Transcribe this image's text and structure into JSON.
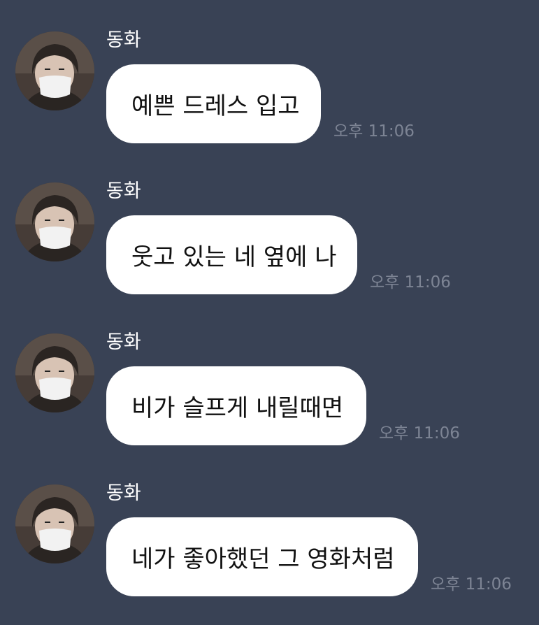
{
  "colors": {
    "background": "#394255",
    "bubble": "#ffffff",
    "bubble_text": "#111111",
    "sender_text": "#ffffff",
    "timestamp_text": "#7d8494"
  },
  "messages": [
    {
      "sender": "동화",
      "text": "예쁜 드레스 입고",
      "time": "오후 11:06",
      "avatar_icon": "profile-photo"
    },
    {
      "sender": "동화",
      "text": "웃고 있는 네 옆에 나",
      "time": "오후 11:06",
      "avatar_icon": "profile-photo"
    },
    {
      "sender": "동화",
      "text": "비가 슬프게 내릴때면",
      "time": "오후 11:06",
      "avatar_icon": "profile-photo"
    },
    {
      "sender": "동화",
      "text": "네가 좋아했던 그 영화처럼",
      "time": "오후 11:06",
      "avatar_icon": "profile-photo"
    }
  ]
}
